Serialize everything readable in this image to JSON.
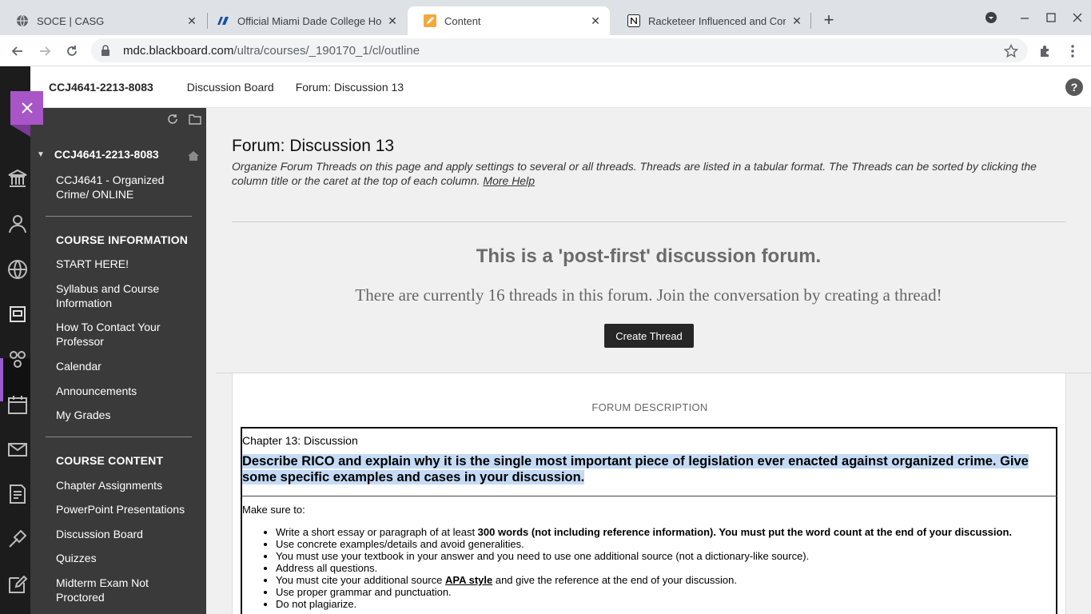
{
  "browser": {
    "tabs": [
      {
        "title": "SOCE | CASG",
        "icon": "globe-icon"
      },
      {
        "title": "Official Miami Dade College Hom",
        "icon": "mdc-logo-icon"
      },
      {
        "title": "Content",
        "icon": "pencil-icon"
      },
      {
        "title": "Racketeer Influenced and Corrup",
        "icon": "notion-icon"
      }
    ],
    "url_host": "mdc.blackboard.com",
    "url_path": "/ultra/courses/_190170_1/cl/outline"
  },
  "course_bar": {
    "course_code": "CCJ4641-2213-8083",
    "crumb_1": "Discussion Board",
    "crumb_2": "Forum: Discussion 13",
    "help": "?"
  },
  "course_menu": {
    "title": "CCJ4641-2213-8083",
    "subtitle": "CCJ4641 - Organized Crime/ ONLINE",
    "section_info": "COURSE INFORMATION",
    "info_items": [
      "START HERE!",
      "Syllabus and Course Information",
      "How To Contact Your Professor",
      "Calendar",
      "Announcements",
      "My Grades"
    ],
    "section_content": "COURSE CONTENT",
    "content_items": [
      "Chapter Assignments",
      "PowerPoint Presentations",
      "Discussion Board",
      "Quizzes",
      "Midterm Exam Not Proctored"
    ]
  },
  "forum": {
    "title": "Forum: Discussion 13",
    "description": "Organize Forum Threads on this page and apply settings to several or all threads. Threads are listed in a tabular format. The Threads can be sorted by clicking the column title or the caret at the top of each column.",
    "more_help": "More Help",
    "post_first": "This is a 'post-first' discussion forum.",
    "threads_text": "There are currently 16 threads in this forum. Join the conversation by creating a thread!",
    "create_thread": "Create Thread",
    "description_label": "FORUM DESCRIPTION",
    "chapter": "Chapter 13: Discussion",
    "prompt": "Describe RICO and explain why it is the single most important piece of legislation ever enacted against organized crime. Give some specific examples and cases in your discussion.",
    "make_sure": "Make sure to:",
    "bullet_1_pre": "Write a short essay or paragraph of at least ",
    "bullet_1_bold": "300 words (not including reference information). You must put the word count at the end of your discussion.",
    "bullet_2": "Use concrete examples/details and avoid generalities.",
    "bullet_3": "You must use your textbook in your answer and you need to use one additional source (not a dictionary-like source).",
    "bullet_4": "Address all questions.",
    "bullet_5_pre": "You must cite your additional source ",
    "bullet_5_link": "APA style",
    "bullet_5_post": " and give the reference at the end of your discussion.",
    "bullet_6": "Use proper grammar and punctuation.",
    "bullet_7": "Do not plagiarize."
  },
  "colors": {
    "accent_purple": "#a855c7",
    "menu_bg": "#3a3a3a",
    "rail_bg": "#1c1c1c",
    "highlight": "#c4daf5"
  }
}
